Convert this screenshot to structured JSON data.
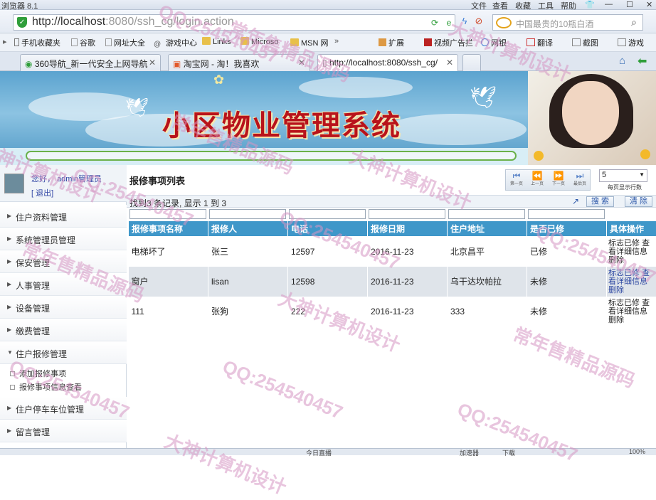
{
  "browser": {
    "app_title": "浏览器 8.1",
    "menu": [
      "文件",
      "查看",
      "收藏",
      "工具",
      "帮助"
    ],
    "url_host": "http://localhost",
    "url_rest": ":8080/ssh_cg/login.action",
    "search_placeholder": "中国最贵的10瓶白酒",
    "favorites": [
      "手机收藏夹",
      "谷歌",
      "网址大全",
      "游戏中心",
      "Links",
      "Microso",
      "MSN 网"
    ],
    "tools": [
      "扩展",
      "视频广告拦",
      "网银",
      "翻译",
      "截图",
      "游戏"
    ],
    "tabs": [
      {
        "label": "360导航_新一代安全上网导航"
      },
      {
        "label": "淘宝网 - 淘！我喜欢"
      },
      {
        "label": "http://localhost:8080/ssh_cg/"
      }
    ],
    "status": [
      "今日直播",
      "加速器",
      "下载",
      "100%"
    ]
  },
  "banner": {
    "title": "小区物业管理系统"
  },
  "sidebar": {
    "greeting": "您好，",
    "user": "admin",
    "role": "管理员",
    "logout": "[ 退出]",
    "menus": [
      {
        "label": "住户资料管理"
      },
      {
        "label": "系统管理员管理"
      },
      {
        "label": "保安管理"
      },
      {
        "label": "人事管理"
      },
      {
        "label": "设备管理"
      },
      {
        "label": "缴费管理"
      },
      {
        "label": "住户报修管理"
      },
      {
        "label": "住户停车车位管理"
      },
      {
        "label": "留言管理"
      }
    ],
    "submenu": [
      {
        "label": "添加报修事项"
      },
      {
        "label": "报修事项信息查看"
      }
    ]
  },
  "main": {
    "list_title": "报修事项列表",
    "pager": {
      "first": "第一页",
      "prev": "上一页",
      "next": "下一页",
      "last": "最后页"
    },
    "page_size": "5",
    "page_size_label": "每页显示行数",
    "record_info": "找到3 条记录, 显示  1 到  3",
    "search_btn": "搜 索",
    "clear_btn": "清 除",
    "columns": [
      "报修事项名称",
      "报修人",
      "电话",
      "报修日期",
      "住户地址",
      "是否已修",
      "具体操作"
    ],
    "rows": [
      {
        "name": "电梯坏了",
        "person": "张三",
        "phone": "12597",
        "date": "2016-11-23",
        "address": "北京昌平",
        "fixed": "已修"
      },
      {
        "name": "窗户",
        "person": "lisan",
        "phone": "12598",
        "date": "2016-11-23",
        "address": "乌干达坎帕拉",
        "fixed": "未修"
      },
      {
        "name": "111",
        "person": "张狗",
        "phone": "222",
        "date": "2016-11-23",
        "address": "333",
        "fixed": "未修"
      }
    ],
    "ops": {
      "mark": "标志已修",
      "detail": "查看详细信息",
      "delete": "删除"
    }
  },
  "watermarks": [
    "常年售精品源码",
    "大神计算机设计",
    "QQ:254540457"
  ]
}
